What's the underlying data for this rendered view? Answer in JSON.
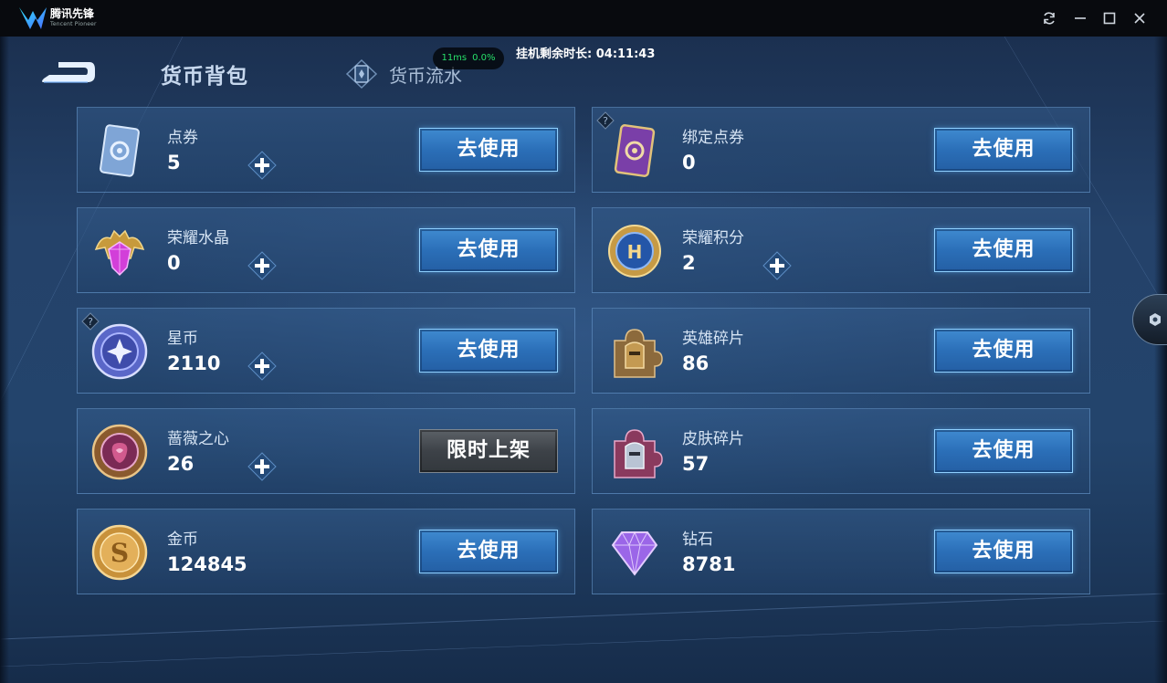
{
  "titlebar": {
    "app_name": "腾讯先锋",
    "app_subtitle": "Tencent Pioneer",
    "icons": [
      "app-logo",
      "refresh-icon",
      "minimize-icon",
      "maximize-icon",
      "close-icon"
    ]
  },
  "header": {
    "back_icon": "back-arrow-icon",
    "tab_bag": "货币背包",
    "tab_flow": "货币流水",
    "ping": "11ms",
    "cpu": "0.0%",
    "idle_time": "挂机剩余时长: 04:11:43"
  },
  "colors": {
    "use_button": "#2f78c2",
    "limited_button": "#454a50",
    "background": "#22406a"
  },
  "currencies": [
    {
      "name": "点券",
      "value": "5",
      "icon": "voucher-card-icon",
      "has_plus": true,
      "has_help": false,
      "action": "去使用",
      "action_style": "blue"
    },
    {
      "name": "绑定点券",
      "value": "0",
      "icon": "bound-voucher-card-icon",
      "has_plus": false,
      "has_help": true,
      "action": "去使用",
      "action_style": "blue"
    },
    {
      "name": "荣耀水晶",
      "value": "0",
      "icon": "glory-crystal-icon",
      "has_plus": true,
      "has_help": false,
      "action": "去使用",
      "action_style": "blue"
    },
    {
      "name": "荣耀积分",
      "value": "2",
      "icon": "glory-points-icon",
      "has_plus": true,
      "has_help": false,
      "action": "去使用",
      "action_style": "blue"
    },
    {
      "name": "星币",
      "value": "2110",
      "icon": "star-coin-icon",
      "has_plus": true,
      "has_help": true,
      "action": "去使用",
      "action_style": "blue"
    },
    {
      "name": "英雄碎片",
      "value": "86",
      "icon": "hero-fragment-icon",
      "has_plus": false,
      "has_help": false,
      "action": "去使用",
      "action_style": "blue"
    },
    {
      "name": "蔷薇之心",
      "value": "26",
      "icon": "rose-heart-icon",
      "has_plus": true,
      "has_help": false,
      "action": "限时上架",
      "action_style": "gray"
    },
    {
      "name": "皮肤碎片",
      "value": "57",
      "icon": "skin-fragment-icon",
      "has_plus": false,
      "has_help": false,
      "action": "去使用",
      "action_style": "blue"
    },
    {
      "name": "金币",
      "value": "124845",
      "icon": "gold-coin-icon",
      "has_plus": false,
      "has_help": false,
      "action": "去使用",
      "action_style": "blue"
    },
    {
      "name": "钻石",
      "value": "8781",
      "icon": "diamond-icon",
      "has_plus": false,
      "has_help": false,
      "action": "去使用",
      "action_style": "blue"
    }
  ]
}
